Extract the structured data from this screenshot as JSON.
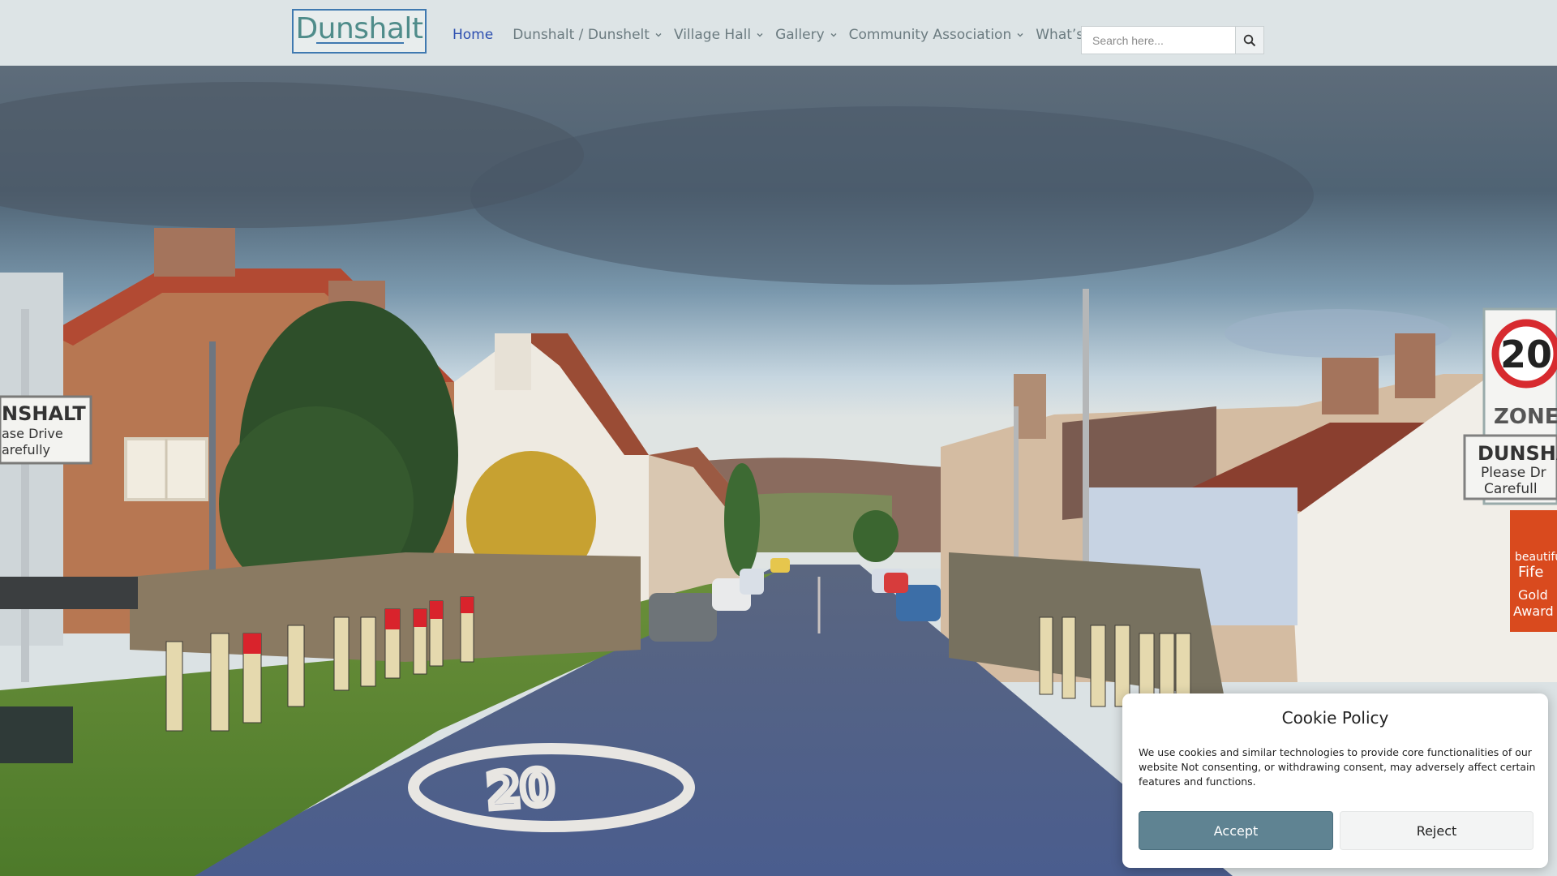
{
  "site": {
    "logo_text": "Dunshalt"
  },
  "nav": {
    "items": [
      {
        "label": "Home",
        "has_dropdown": false,
        "active": true
      },
      {
        "label": "Dunshalt / Dunshelt",
        "has_dropdown": true
      },
      {
        "label": "Village Hall",
        "has_dropdown": true
      },
      {
        "label": "Gallery",
        "has_dropdown": true
      },
      {
        "label": "Community Association",
        "has_dropdown": true
      },
      {
        "label": "What’s On",
        "has_dropdown": true
      }
    ]
  },
  "search": {
    "placeholder": "Search here...",
    "icon": "search-icon"
  },
  "hero": {
    "signs": {
      "left_sign_lines": [
        "NSHALT",
        "ase Drive",
        "arefully"
      ],
      "speed_limit": "20",
      "zone_label": "ZONE",
      "right_sign_lines": [
        "DUNSHA",
        "Please Dr",
        "Carefull"
      ],
      "award_lines": [
        "beautiful",
        "Fife",
        "Gold",
        "Award"
      ],
      "road_marking": "20"
    }
  },
  "cookie": {
    "title": "Cookie Policy",
    "text": "We use cookies and similar technologies to provide core functionalities of our website  Not consenting, or withdrawing consent, may adversely affect certain features and functions.",
    "accept_label": "Accept",
    "reject_label": "Reject"
  },
  "colors": {
    "header_bg": "#dde4e6",
    "nav_active": "#2d4fb0",
    "nav_text": "#6b7b80",
    "accept_bg": "#5f8392"
  }
}
